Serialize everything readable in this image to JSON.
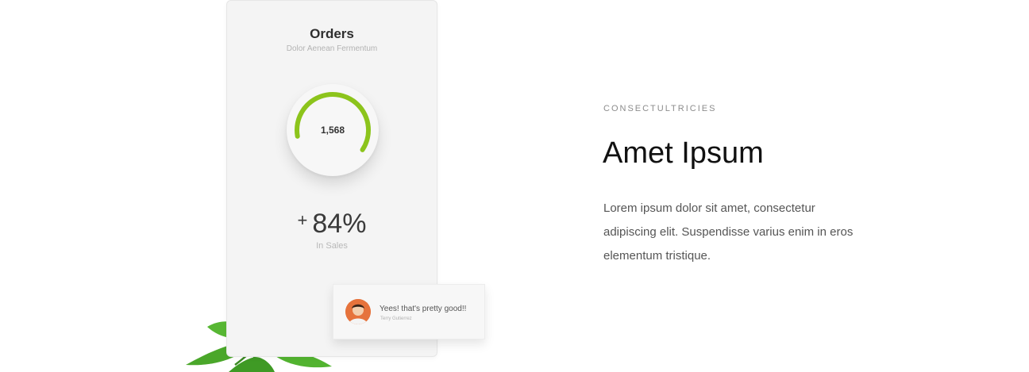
{
  "card": {
    "title": "Orders",
    "subtitle": "Dolor Aenean Fermentum",
    "gauge_value": "1,568",
    "gauge_fill_fraction": 0.62,
    "gauge_color": "#8cc41c",
    "stat_sign": "+",
    "stat_value": "84%",
    "stat_label": "In Sales"
  },
  "chat": {
    "message": "Yees! that's pretty good!!",
    "author": "Terry Gutierrez",
    "avatar_icon": "user-avatar"
  },
  "decoration": {
    "plant_icon": "mint-leaves-icon"
  },
  "content": {
    "eyebrow": "CONSECTULTRICIES",
    "headline": "Amet Ipsum",
    "body": "Lorem ipsum dolor sit amet, consectetur adipiscing elit. Suspendisse varius enim in eros elementum tristique."
  }
}
